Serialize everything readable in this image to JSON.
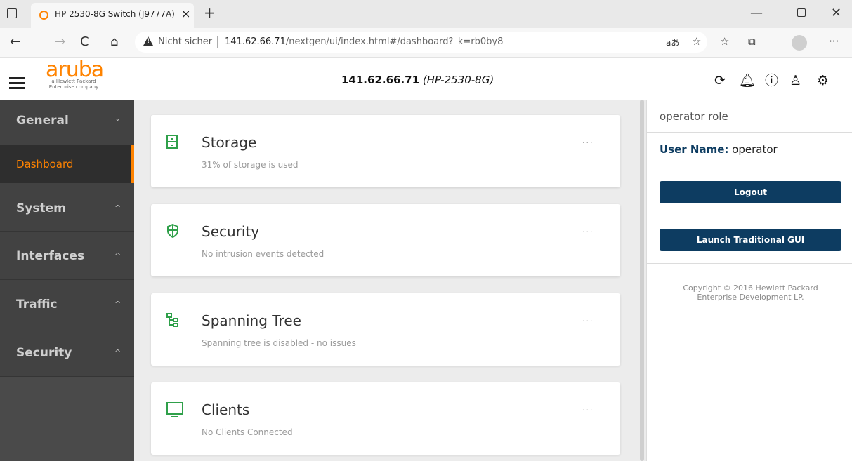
{
  "browser": {
    "tab_title": "HP 2530-8G Switch (J9777A)",
    "tab_close": "×",
    "new_tab": "+",
    "not_secure": "Nicht sicher",
    "url_host": "141.62.66.71",
    "url_path": "/nextgen/ui/index.html#/dashboard?_k=rb0by8",
    "read_aloud": "aあ",
    "back": "←",
    "forward": "→",
    "refresh": "C",
    "home": "⌂",
    "more": "···",
    "minimize": "—",
    "close": "✕"
  },
  "header": {
    "logo_word": "aruba",
    "logo_sub": "a Hewlett Packard Enterprise company",
    "device_ip": "141.62.66.71",
    "device_model": "(HP-2530-8G)"
  },
  "sidebar": {
    "items": [
      {
        "label": "General",
        "chevron": "⌄"
      },
      {
        "label": "System",
        "chevron": "^"
      },
      {
        "label": "Interfaces",
        "chevron": "^"
      },
      {
        "label": "Traffic",
        "chevron": "^"
      },
      {
        "label": "Security",
        "chevron": "^"
      }
    ],
    "active_sub": "Dashboard"
  },
  "cards": [
    {
      "title": "Storage",
      "subtitle": "31% of storage is used",
      "icon": "storage-icon",
      "more": "···"
    },
    {
      "title": "Security",
      "subtitle": "No intrusion events detected",
      "icon": "shield-icon",
      "more": "···"
    },
    {
      "title": "Spanning Tree",
      "subtitle": "Spanning tree is disabled - no issues",
      "icon": "tree-icon",
      "more": "···"
    },
    {
      "title": "Clients",
      "subtitle": "No Clients Connected",
      "icon": "monitor-icon",
      "more": "···"
    }
  ],
  "panel": {
    "role": "operator role",
    "user_key": "User Name:",
    "user_value": "operator",
    "logout": "Logout",
    "launch": "Launch Traditional GUI",
    "copyright": "Copyright © 2016 Hewlett Packard Enterprise Development LP."
  },
  "colors": {
    "accent": "#ff8300",
    "primary_button": "#0d3c61",
    "icon_green": "#2fa04a",
    "sidebar_bg": "#424242"
  }
}
